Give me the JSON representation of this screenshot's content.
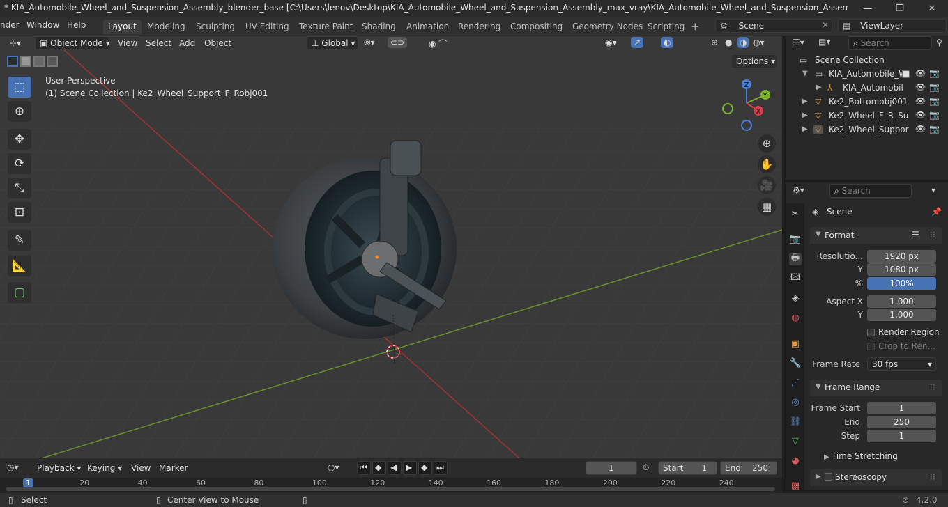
{
  "window": {
    "title": "* KIA_Automobile_Wheel_and_Suspension_Assembly_blender_base [C:\\Users\\lenov\\Desktop\\KIA_Automobile_Wheel_and_Suspension_Assembly_max_vray\\KIA_Automobile_Wheel_and_Suspension_Assembly_blender_base.ble...",
    "min": "—",
    "max": "❐",
    "close": "✕"
  },
  "menus": {
    "render": "nder",
    "window": "Window",
    "help": "Help"
  },
  "workspaces": [
    "Layout",
    "Modeling",
    "Sculpting",
    "UV Editing",
    "Texture Paint",
    "Shading",
    "Animation",
    "Rendering",
    "Compositing",
    "Geometry Nodes",
    "Scripting"
  ],
  "add_workspace": "+",
  "scene": {
    "label": "Scene",
    "viewlayer": "ViewLayer"
  },
  "viewport": {
    "mode": "Object Mode",
    "view": "View",
    "select": "Select",
    "add": "Add",
    "object": "Object",
    "orientation": "Global",
    "options": "Options",
    "info_line1": "User Perspective",
    "info_line2": "(1) Scene Collection | Ke2_Wheel_Support_F_Robj001"
  },
  "gizmo": {
    "x": "X",
    "y": "Y",
    "z": "Z"
  },
  "outliner": {
    "search_placeholder": "Search",
    "root": "Scene Collection",
    "items": [
      {
        "label": "KIA_Automobile_W",
        "level": 1
      },
      {
        "label": "KIA_Automobil",
        "level": 2
      },
      {
        "label": "Ke2_Bottomobj001",
        "level": 1
      },
      {
        "label": "Ke2_Wheel_F_R_Su",
        "level": 1
      },
      {
        "label": "Ke2_Wheel_Suppor",
        "level": 1
      }
    ]
  },
  "properties": {
    "search_placeholder": "Search",
    "context": "Scene",
    "format": {
      "title": "Format",
      "res_label": "Resolutio...",
      "res_x": "1920 px",
      "y_label": "Y",
      "res_y": "1080 px",
      "pct_label": "%",
      "pct": "100%",
      "aspect_label": "Aspect X",
      "aspect_x": "1.000",
      "aspect_y_label": "Y",
      "aspect_y": "1.000",
      "render_region": "Render Region",
      "crop": "Crop to Ren...",
      "fr_label": "Frame Rate",
      "frame_rate": "30 fps"
    },
    "frame_range": {
      "title": "Frame Range",
      "start_label": "Frame Start",
      "start": "1",
      "end_label": "End",
      "end": "250",
      "step_label": "Step",
      "step": "1"
    },
    "time_stretching": "Time Stretching",
    "stereoscopy": "Stereoscopy"
  },
  "timeline": {
    "playback": "Playback",
    "keying": "Keying",
    "view": "View",
    "marker": "Marker",
    "current": "1",
    "start_label": "Start",
    "start": "1",
    "end_label": "End",
    "end": "250",
    "ticks": [
      "1",
      "20",
      "40",
      "60",
      "80",
      "100",
      "120",
      "140",
      "160",
      "180",
      "200",
      "220",
      "240"
    ]
  },
  "status": {
    "select": "Select",
    "center": "Center View to Mouse",
    "version": "4.2.0"
  }
}
